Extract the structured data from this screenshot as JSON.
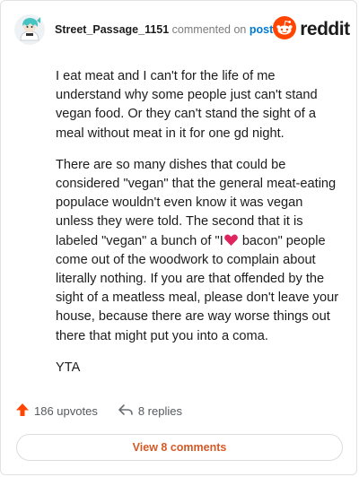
{
  "header": {
    "username": "Street_Passage_1151",
    "action_text": "commented on",
    "post_link": "post",
    "brand": "reddit"
  },
  "comment": {
    "paragraphs": [
      {
        "text": "I eat meat and I can't for the life of me understand why some people just can't stand vegan food. Or they can't stand the sight of a meal without meat in it for one gd night."
      },
      {
        "before_heart": "There are so many dishes that could be considered \"vegan\" that the general meat-eating populace wouldn't even know it was vegan unless they were told. The second that it is labeled \"vegan\" a bunch of \"I",
        "after_heart": "bacon\" people come out of the woodwork to complain about literally nothing. If you are that offended by the sight of a meatless meal, please don't leave your house, because there are way worse things out there that might put you into a coma."
      },
      {
        "text": "YTA"
      }
    ]
  },
  "footer": {
    "upvotes": "186 upvotes",
    "replies": "8 replies",
    "view_button": "View 8 comments"
  },
  "colors": {
    "upvote": "#ff4500",
    "link": "#0079d3",
    "button_text": "#d25a28",
    "heart": "#e0245e"
  }
}
